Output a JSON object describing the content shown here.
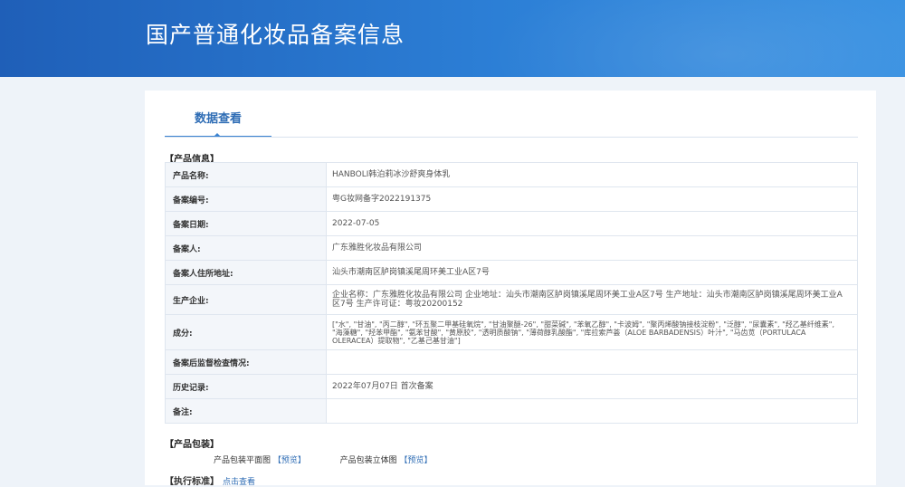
{
  "header": {
    "title": "国产普通化妆品备案信息"
  },
  "tab": {
    "label": "数据查看"
  },
  "product_section": {
    "label": "【产品信息】"
  },
  "fields": [
    {
      "label": "产品名称:",
      "value": "HANBOLI韩泊莉冰沙舒爽身体乳"
    },
    {
      "label": "备案编号:",
      "value": "粤G妆网备字2022191375"
    },
    {
      "label": "备案日期:",
      "value": "2022-07-05"
    },
    {
      "label": "备案人:",
      "value": "广东雅胜化妆品有限公司"
    },
    {
      "label": "备案人住所地址:",
      "value": "汕头市潮南区胪岗镇溪尾周环美工业A区7号"
    },
    {
      "label": "生产企业:",
      "value": "企业名称：广东雅胜化妆品有限公司 企业地址：汕头市潮南区胪岗镇溪尾周环美工业A区7号 生产地址：汕头市潮南区胪岗镇溪尾周环美工业A区7号 生产许可证：粤妆20200152"
    },
    {
      "label": "成分:",
      "value": "[\"水\", \"甘油\", \"丙二醇\", \"环五聚二甲基硅氧烷\", \"甘油聚醚-26\", \"甜菜碱\", \"苯氧乙醇\", \"卡波姆\", \"聚丙烯酸钠接枝淀粉\", \"泛醇\", \"尿囊素\", \"羟乙基纤维素\", \"海藻糖\", \"羟苯甲酯\", \"氨苯甘酸\", \"黄原胶\", \"透明质酸钠\", \"薄荷醇乳酸酯\", \"库拉索芦荟（ALOE BARBADENSIS）叶汁\", \"马齿苋（PORTULACA OLERACEA）提取物\", \"乙基己基甘油\"]"
    },
    {
      "label": "备案后监督检查情况:",
      "value": ""
    },
    {
      "label": "历史记录:",
      "value": "2022年07月07日 首次备案"
    },
    {
      "label": "备注:",
      "value": ""
    }
  ],
  "packaging": {
    "label": "【产品包装】",
    "flat_label": "产品包装平面图",
    "flat_link": "【预览】",
    "solid_label": "产品包装立体图",
    "solid_link": "【预览】"
  },
  "standard": {
    "label": "【执行标准】",
    "link": "点击查看"
  }
}
